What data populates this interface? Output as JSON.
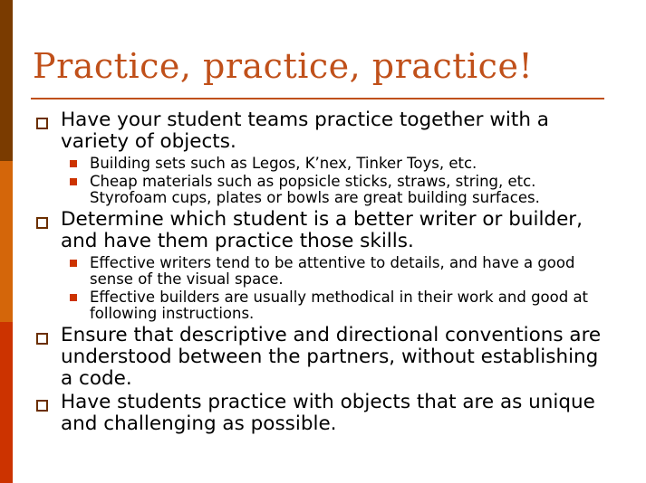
{
  "slide": {
    "title": "Practice, practice, practice!",
    "accent_colors": {
      "dark": "#7a3b00",
      "mid": "#d4660a",
      "light": "#cc3300",
      "title": "#c0501a"
    },
    "items": [
      {
        "text": "Have your student teams practice together with a variety of objects.",
        "subitems": [
          "Building sets such as Legos, K’nex, Tinker Toys, etc.",
          "Cheap materials such as popsicle sticks, straws, string, etc. Styrofoam cups, plates or bowls are great building surfaces."
        ]
      },
      {
        "text": "Determine which student is a better writer or builder, and have them practice those skills.",
        "subitems": [
          "Effective writers tend to be attentive to details, and have a good sense of the visual space.",
          "Effective builders are usually methodical in their work and good at following instructions."
        ]
      },
      {
        "text": "Ensure that descriptive and directional conventions are understood between the partners, without establishing a code.",
        "subitems": []
      },
      {
        "text": "Have students practice with objects that are as unique and challenging as possible.",
        "subitems": []
      }
    ]
  }
}
